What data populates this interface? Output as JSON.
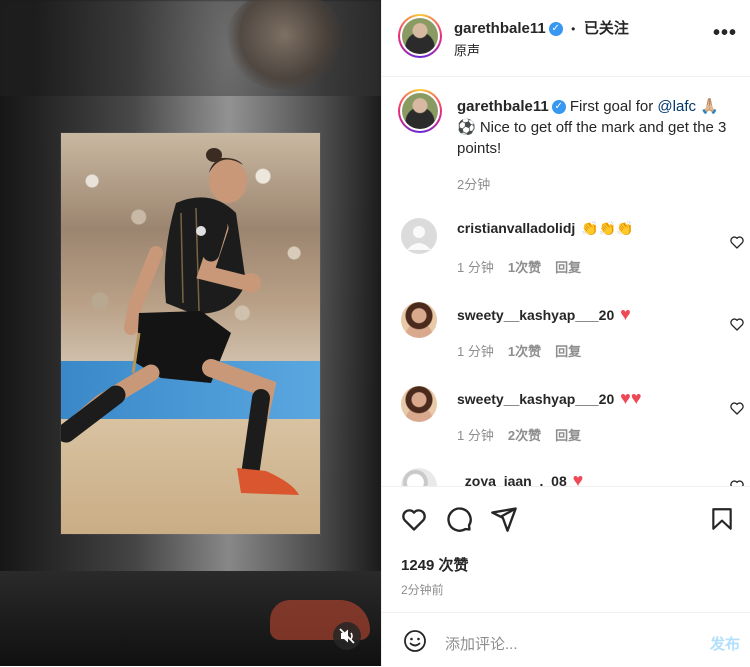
{
  "post": {
    "username": "garethbale11",
    "verified_mark": "✓",
    "separator": "•",
    "follow_status": "已关注",
    "audio": "原声",
    "more_label": "•••"
  },
  "caption": {
    "username": "garethbale11",
    "text_before": "First goal for ",
    "mention": "@lafc",
    "text_after": " 🙏🏼⚽ Nice to get off the mark and get the 3 points!",
    "time": "2分钟"
  },
  "comments": [
    {
      "username": "cristianvalladolidj",
      "emoji": "👏👏👏",
      "time": "1 分钟",
      "likes": "1次赞",
      "reply": "回复",
      "avatar": "default-avatar"
    },
    {
      "username": "sweety__kashyap___20",
      "emoji": "♥",
      "time": "1 分钟",
      "likes": "1次赞",
      "reply": "回复",
      "avatar": "woman-avatar"
    },
    {
      "username": "sweety__kashyap___20",
      "emoji": "♥♥",
      "time": "1 分钟",
      "likes": "2次赞",
      "reply": "回复",
      "avatar": "woman-avatar"
    },
    {
      "username": "_zoya_jaan_._08",
      "emoji": "♥",
      "time": "",
      "likes": "",
      "reply": "",
      "avatar": "ball-avatar"
    }
  ],
  "actions": {
    "likes_count": "1249 次赞",
    "posted_ago": "2分钟前"
  },
  "composer": {
    "placeholder": "添加评论...",
    "post_label": "发布"
  },
  "colors": {
    "accent": "#0095f6",
    "link": "#00376b",
    "heart": "#ed4956",
    "post_disabled": "#b2dffc"
  }
}
